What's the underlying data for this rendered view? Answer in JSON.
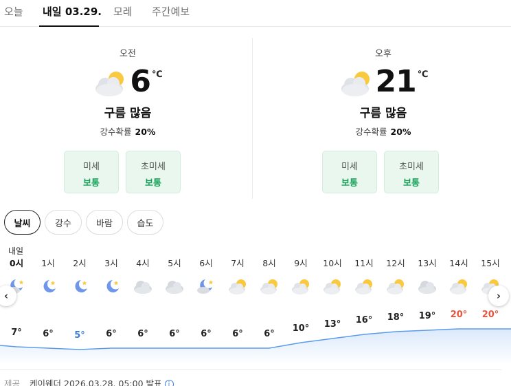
{
  "tabs": [
    {
      "label": "오늘"
    },
    {
      "label": "내일 03.29."
    },
    {
      "label": "모레"
    },
    {
      "label": "주간예보"
    }
  ],
  "summary": {
    "am": {
      "period": "오전",
      "temp": "6",
      "unit": "℃",
      "condition": "구름 많음",
      "rain_label": "강수확률",
      "rain_value": "20%",
      "icon": "partly-cloudy-icon",
      "dust": [
        {
          "label": "미세",
          "value": "보통"
        },
        {
          "label": "초미세",
          "value": "보통"
        }
      ]
    },
    "pm": {
      "period": "오후",
      "temp": "21",
      "unit": "℃",
      "condition": "구름 많음",
      "rain_label": "강수확률",
      "rain_value": "20%",
      "icon": "partly-cloudy-icon",
      "dust": [
        {
          "label": "미세",
          "value": "보통"
        },
        {
          "label": "초미세",
          "value": "보통"
        }
      ]
    }
  },
  "chips": [
    {
      "label": "날씨",
      "active": true
    },
    {
      "label": "강수",
      "active": false
    },
    {
      "label": "바람",
      "active": false
    },
    {
      "label": "습도",
      "active": false
    }
  ],
  "hourly": {
    "day_label": "내일",
    "hours": [
      {
        "label": "0시",
        "icon": "moon-cloud-icon",
        "temp": "7°",
        "color": "#222222"
      },
      {
        "label": "1시",
        "icon": "moon-icon",
        "temp": "6°",
        "color": "#222222"
      },
      {
        "label": "2시",
        "icon": "moon-icon",
        "temp": "5°",
        "color": "#3d7bd9"
      },
      {
        "label": "3시",
        "icon": "moon-icon",
        "temp": "6°",
        "color": "#222222"
      },
      {
        "label": "4시",
        "icon": "cloud-icon",
        "temp": "6°",
        "color": "#222222"
      },
      {
        "label": "5시",
        "icon": "cloud-icon",
        "temp": "6°",
        "color": "#222222"
      },
      {
        "label": "6시",
        "icon": "moon-cloud-icon",
        "temp": "6°",
        "color": "#222222"
      },
      {
        "label": "7시",
        "icon": "partly-cloudy-icon",
        "temp": "6°",
        "color": "#222222"
      },
      {
        "label": "8시",
        "icon": "partly-cloudy-icon",
        "temp": "6°",
        "color": "#222222"
      },
      {
        "label": "9시",
        "icon": "partly-cloudy-icon",
        "temp": "10°",
        "color": "#222222"
      },
      {
        "label": "10시",
        "icon": "partly-cloudy-icon",
        "temp": "13°",
        "color": "#222222"
      },
      {
        "label": "11시",
        "icon": "partly-cloudy-icon",
        "temp": "16°",
        "color": "#222222"
      },
      {
        "label": "12시",
        "icon": "partly-cloudy-icon",
        "temp": "18°",
        "color": "#222222"
      },
      {
        "label": "13시",
        "icon": "cloud-icon",
        "temp": "19°",
        "color": "#222222"
      },
      {
        "label": "14시",
        "icon": "partly-cloudy-icon",
        "temp": "20°",
        "color": "#e8553c"
      },
      {
        "label": "15시",
        "icon": "partly-cloudy-icon",
        "temp": "20°",
        "color": "#e8553c"
      }
    ]
  },
  "chart_data": {
    "type": "area",
    "x": [
      "0시",
      "1시",
      "2시",
      "3시",
      "4시",
      "5시",
      "6시",
      "7시",
      "8시",
      "9시",
      "10시",
      "11시",
      "12시",
      "13시",
      "14시",
      "15시"
    ],
    "series": [
      {
        "values": [
          7,
          6,
          5,
          6,
          6,
          6,
          6,
          6,
          6,
          10,
          13,
          16,
          18,
          19,
          20,
          20
        ]
      }
    ],
    "line_color": "#5b9bea"
  },
  "footer": {
    "label": "제공",
    "text": "케이웨더 2026.03.28. 05:00 발표",
    "info": "i"
  }
}
